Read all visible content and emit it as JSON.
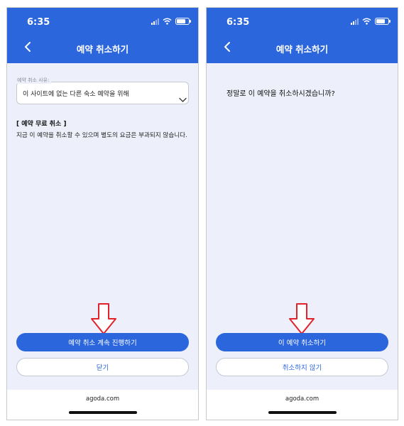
{
  "status_bar": {
    "time": "6:35",
    "icons": [
      "cellular-signal-icon",
      "wifi-icon",
      "battery-icon"
    ]
  },
  "colors": {
    "header": "#2b66dd",
    "primary": "#2b66dd",
    "background": "#edf0fa",
    "arrow": "#e0232a"
  },
  "screen_left": {
    "header_title": "예약 취소하기",
    "reason_label": "예약 취소 사유:",
    "reason_value": "이 사이트에 없는 다른 숙소 예약을 위해",
    "free_cancel_title": "[ 예약 무료 취소 ]",
    "free_cancel_desc": "지금 이 예약을 취소할 수 있으며 별도의 요금은 부과되지 않습니다.",
    "primary_button": "예약 취소 계속 진행하기",
    "secondary_button": "닫기",
    "footer": "agoda.com"
  },
  "screen_right": {
    "header_title": "예약 취소하기",
    "question": "정말로 이 예약을 취소하시겠습니까?",
    "primary_button": "이 예약 취소하기",
    "secondary_button": "취소하지 않기",
    "footer": "agoda.com"
  }
}
